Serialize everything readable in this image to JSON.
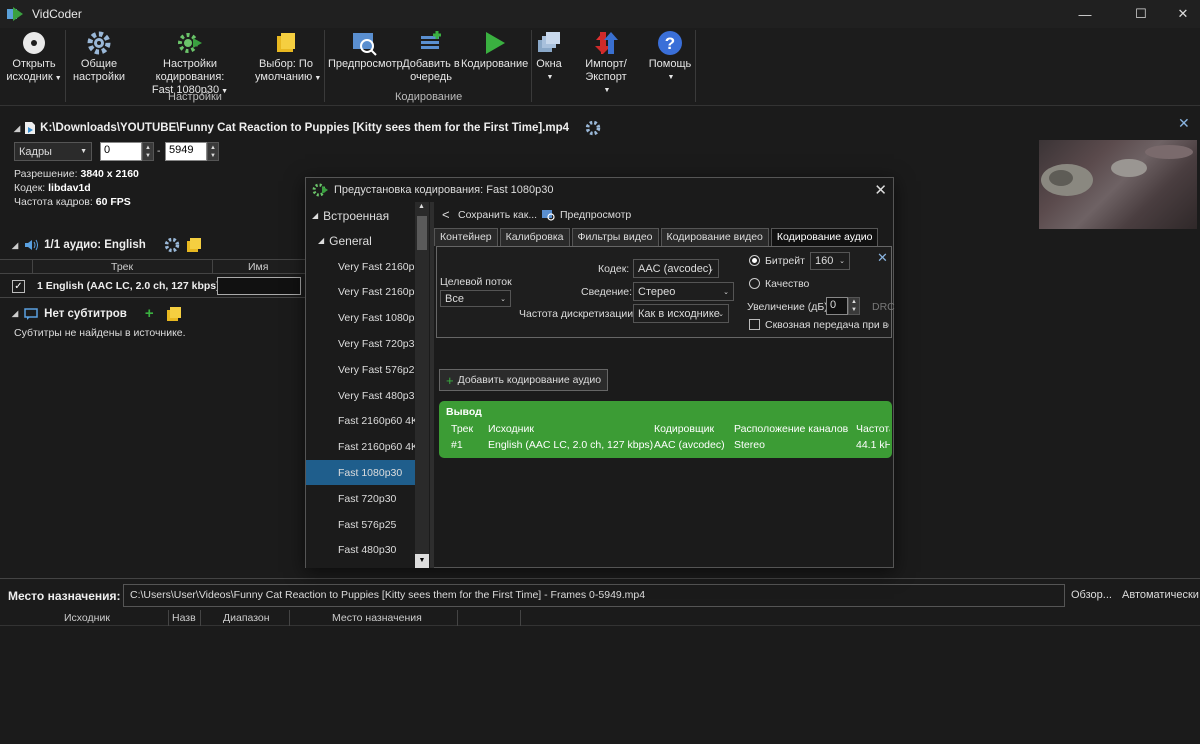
{
  "app": {
    "title": "VidCoder"
  },
  "window_controls": {
    "minimize": "—",
    "maximize": "☐",
    "close": "✕"
  },
  "toolbar": {
    "open_source": [
      "Открыть",
      "исходник"
    ],
    "general_settings": [
      "Общие",
      "настройки"
    ],
    "encode_settings": [
      "Настройки кодирования:",
      "Fast 1080p30"
    ],
    "pick": [
      "Выбор: По",
      "умолчанию"
    ],
    "preview": "Предпросмотр",
    "add_queue": [
      "Добавить в",
      "очередь"
    ],
    "encode": "Кодирование",
    "windows": "Окна",
    "import_export": "Импорт/Экспорт",
    "help": "Помощь",
    "group_settings": "Настройки",
    "group_encoding": "Кодирование"
  },
  "source": {
    "path": "K:\\Downloads\\YOUTUBE\\Funny Cat Reaction to Puppies [Kitty sees them for the First Time].mp4",
    "range_type": "Кадры",
    "range_start": "0",
    "range_sep": "-",
    "range_end": "5949",
    "resolution_label": "Разрешение:",
    "resolution": "3840 x 2160",
    "codec_label": "Кодек:",
    "codec": "libdav1d",
    "fps_label": "Частота кадров:",
    "fps": "60  FPS"
  },
  "audio": {
    "header": "1/1 аудио: English",
    "col_track": "Трек",
    "col_name": "Имя",
    "track": "1 English (AAC LC, 2.0 ch, 127 kbps)"
  },
  "subtitles": {
    "header": "Нет субтитров",
    "none_found": "Субтитры не найдены в источнике."
  },
  "destination": {
    "label": "Место назначения:",
    "path": "C:\\Users\\User\\Videos\\Funny Cat Reaction to Puppies [Kitty sees them for the First Time] - Frames 0-5949.mp4",
    "browse": "Обзор...",
    "auto": "Автоматически"
  },
  "queue": {
    "cols": [
      "Исходник",
      "Назв",
      "Диапазон",
      "Место назначения"
    ]
  },
  "dialog": {
    "title": "Предустановка кодирования: Fast 1080p30",
    "tree": {
      "builtin": "Встроенная",
      "general": "General",
      "items": [
        "Very Fast 2160p60",
        "Very Fast 2160p60",
        "Very Fast 1080p30",
        "Very Fast 720p30",
        "Very Fast 576p25",
        "Very Fast 480p30",
        "Fast 2160p60 4K",
        "Fast 2160p60 4K",
        "Fast 1080p30",
        "Fast 720p30",
        "Fast 576p25",
        "Fast 480p30"
      ],
      "items_display": [
        "Very Fast 2160p",
        "Very Fast 2160p",
        "Very Fast 1080p3",
        "Very Fast 720p3(",
        "Very Fast 576p2!",
        "Very Fast 480p3(",
        "Fast 2160p60 4K",
        "Fast 2160p60 4K",
        "Fast 1080p30",
        "Fast 720p30",
        "Fast 576p25",
        "Fast 480p30"
      ],
      "selected_index": 8
    },
    "save_as": "Сохранить как...",
    "preview": "Предпросмотр",
    "tabs": [
      "Контейнер",
      "Калибровка",
      "Фильтры видео",
      "Кодирование видео",
      "Кодирование аудио"
    ],
    "active_tab": 4,
    "audio": {
      "target_stream_label": "Целевой поток",
      "target_stream": "Все",
      "codec_label": "Кодек:",
      "codec": "AAC (avcodec)",
      "mixdown_label": "Сведение:",
      "mixdown": "Стерео",
      "samplerate_label": "Частота дискретизации:",
      "samplerate": "Как в исходнике",
      "bitrate_label": "Битрейт",
      "bitrate": "160",
      "quality_label": "Качество",
      "gain_label": "Увеличение (дБ):",
      "gain": "0",
      "drc": "DRC",
      "passthru_label": "Сквозная передача при вс"
    },
    "add_audio": "Добавить кодирование  аудио",
    "output": {
      "header": "Вывод",
      "col_track": "Трек",
      "col_source": "Исходник",
      "col_encoder": "Кодировщик",
      "col_channels": "Расположение каналов",
      "col_rate": "Частота",
      "track": "#1",
      "source": "English (AAC LC, 2.0 ch, 127 kbps)",
      "encoder": "AAC (avcodec)",
      "channels": "Stereo",
      "rate": "44.1 kH"
    }
  }
}
